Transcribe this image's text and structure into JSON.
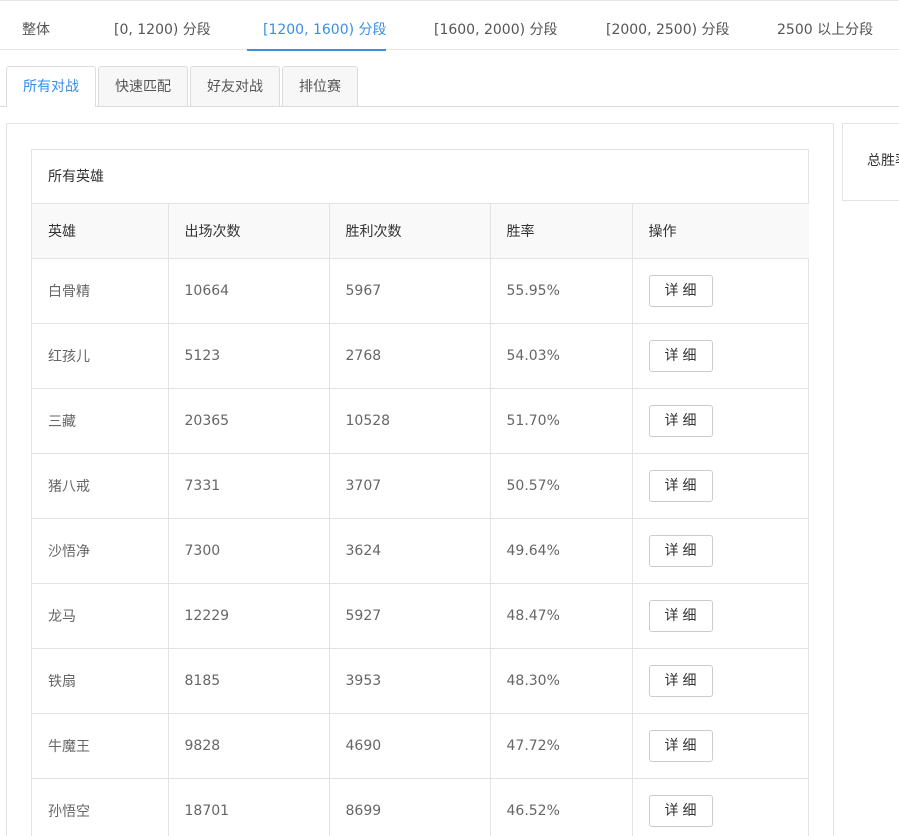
{
  "segment_tabs": [
    {
      "label": "整体"
    },
    {
      "label": "[0, 1200) 分段"
    },
    {
      "label": "[1200, 1600) 分段"
    },
    {
      "label": "[1600, 2000) 分段"
    },
    {
      "label": "[2000, 2500) 分段"
    },
    {
      "label": "2500 以上分段"
    }
  ],
  "mode_tabs": [
    {
      "label": "所有对战"
    },
    {
      "label": "快速匹配"
    },
    {
      "label": "好友对战"
    },
    {
      "label": "排位赛"
    }
  ],
  "side_panel": {
    "title": "总胜率"
  },
  "hero_panel": {
    "title": "所有英雄",
    "headers": {
      "hero": "英雄",
      "appearances": "出场次数",
      "wins": "胜利次数",
      "win_rate": "胜率",
      "action": "操作"
    },
    "detail_label": "详细",
    "rows": [
      {
        "hero": "白骨精",
        "appearances": "10664",
        "wins": "5967",
        "win_rate": "55.95%"
      },
      {
        "hero": "红孩儿",
        "appearances": "5123",
        "wins": "2768",
        "win_rate": "54.03%"
      },
      {
        "hero": "三藏",
        "appearances": "20365",
        "wins": "10528",
        "win_rate": "51.70%"
      },
      {
        "hero": "猪八戒",
        "appearances": "7331",
        "wins": "3707",
        "win_rate": "50.57%"
      },
      {
        "hero": "沙悟净",
        "appearances": "7300",
        "wins": "3624",
        "win_rate": "49.64%"
      },
      {
        "hero": "龙马",
        "appearances": "12229",
        "wins": "5927",
        "win_rate": "48.47%"
      },
      {
        "hero": "铁扇",
        "appearances": "8185",
        "wins": "3953",
        "win_rate": "48.30%"
      },
      {
        "hero": "牛魔王",
        "appearances": "9828",
        "wins": "4690",
        "win_rate": "47.72%"
      },
      {
        "hero": "孙悟空",
        "appearances": "18701",
        "wins": "8699",
        "win_rate": "46.52%"
      }
    ]
  },
  "colors": {
    "accent": "#3a8ee6"
  }
}
